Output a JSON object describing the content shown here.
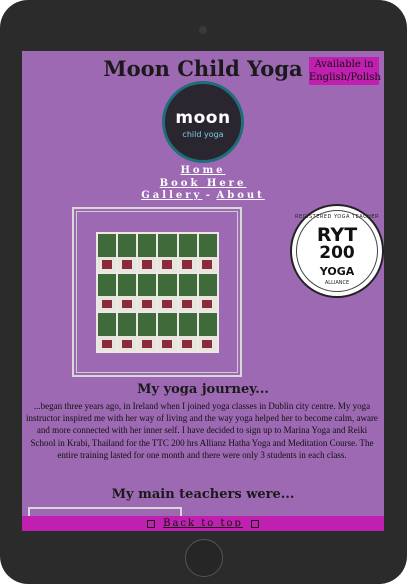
{
  "site": {
    "title": "Moon Child Yoga",
    "language_badge": "Available in English/Polish"
  },
  "logo": {
    "word": "moon",
    "sub": "child yoga"
  },
  "nav": {
    "home": "Home",
    "book": "Book Here",
    "gallery": "Gallery",
    "separator": "-",
    "about": "About"
  },
  "badge": {
    "top_text": "REGISTERED YOGA TEACHER",
    "ryt": "RYT",
    "hours": "200",
    "yoga": "YOGA",
    "alliance": "ALLIANCE"
  },
  "journey": {
    "heading": "My yoga journey...",
    "text": "...began three years ago, in Ireland when I joined yoga classes in Dublin city centre. My yoga instructor inspired me with her way of living and the way yoga helped her to become calm, aware and more connected with her inner self. I have decided to sign up to Marina Yoga and Reiki School in Krabi, Thailand for the TTC 200 hrs Allianz Hatha Yoga and Meditation Course. The entire training lasted for one month and there were only 3 students in each class."
  },
  "teachers": {
    "heading": "My main teachers were..."
  },
  "footer": {
    "back_to_top": "Back to top"
  },
  "icons": {
    "footer_left": "square-icon",
    "footer_right": "facebook-icon"
  },
  "colors": {
    "page_background": "#9d69b3",
    "accent": "#c11fb0",
    "device_frame": "#2b2b2b"
  }
}
